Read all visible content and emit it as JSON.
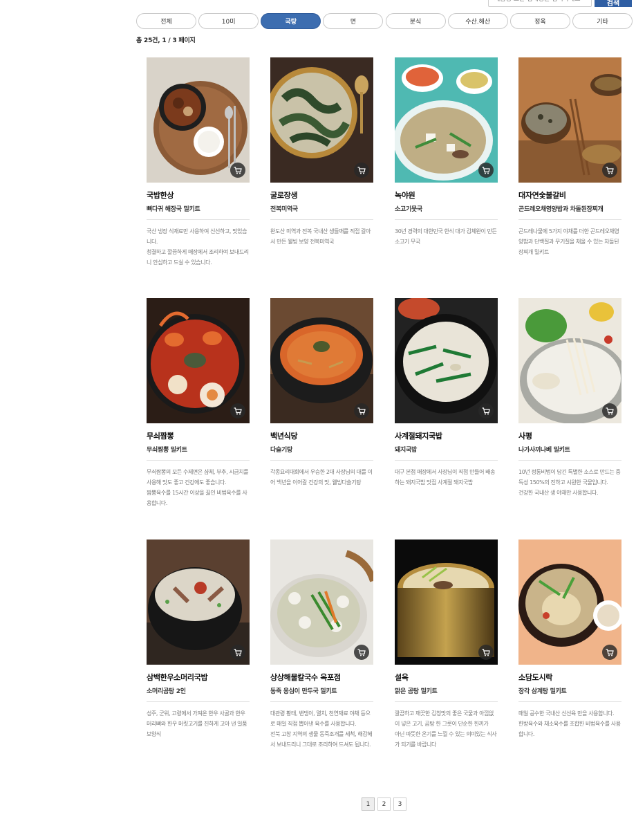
{
  "search": {
    "placeholder": "제품명 또는 업체명을 입력하세요",
    "button_label": "검색"
  },
  "tabs": [
    {
      "label": "전체",
      "active": false
    },
    {
      "label": "10미",
      "active": false
    },
    {
      "label": "국탕",
      "active": true
    },
    {
      "label": "면",
      "active": false
    },
    {
      "label": "분식",
      "active": false
    },
    {
      "label": "수산.해산",
      "active": false
    },
    {
      "label": "정육",
      "active": false
    },
    {
      "label": "기타",
      "active": false
    }
  ],
  "result_summary": "총 25건, 1 / 3 페이지",
  "products": [
    {
      "store": "국밥한상",
      "name": "뼈다귀 해장국 밀키트",
      "desc": "국산 냉장 식재료만 사용하여 신선하고, 맛있습니다.\n청결하고 깔끔하게 매장에서 조리하여 보내드리니 안심하고 드실 수 있습니다.",
      "icon": "cart-icon"
    },
    {
      "store": "굴로장생",
      "name": "전복미역국",
      "desc": "완도산 미역과 전복 국내산 생들깨를 직접 갈아서 만든 웰빙 보양 전복미역국",
      "icon": "cart-icon"
    },
    {
      "store": "녹야원",
      "name": "소고기뭇국",
      "desc": "30년 경력의 대한민국 한식 대가 김체완이 만든 소고기 무국",
      "icon": "cart-icon"
    },
    {
      "store": "대자연숯불갈비",
      "name": "곤드레오채영양밥과 차돌된장찌개",
      "desc": "곤드레나물에 5가지 야채를 더한 곤드레오채영양밥과 단백질과 무기질을 채울 수 있는 차돌된장찌개 밀키트",
      "icon": "cart-icon"
    },
    {
      "store": "무쇠짬뽕",
      "name": "무쇠짬뽕 밀키트",
      "desc": "무쇠짬뽕의 모든 수제면은 샴체, 부추, 시금치를 사용해 맛도 좋고 건강에도 좋습니다.\n짬뽕육수를 15시간 이상을 끓인 비법육수를 사용합니다.",
      "icon": "cart-icon"
    },
    {
      "store": "백년식당",
      "name": "다슬기탕",
      "desc": "각종요리대회에서 우승한 2대 사장님의 대를 이어 백년을 이어갈 건강의 맛, 웰빙다슬기탕",
      "icon": "cart-icon"
    },
    {
      "store": "사계절돼지국밥",
      "name": "돼지국밥",
      "desc": "대구 본점 매장에서 사장님이 직접 만들어 배송하는 돼지국밥 맛집 사계절 돼지국밥",
      "icon": "cart-icon"
    },
    {
      "store": "사평",
      "name": "나가사끼나베 밀키트",
      "desc": "10년 정통비법이 담긴 특별한 소스로 만드는 중독성 150%의 진하고 시원한 국물입니다.\n건강한 국내산 생 야채만 사용합니다.",
      "icon": "cart-icon"
    },
    {
      "store": "삼백한우소머리국밥",
      "name": "소머리곰탕 2인",
      "desc": "성주, 군위, 고령에서 가져온 한우 사골과 한우 머리뼈와 한우 머릿고기를 진하게 고아 낸 일품 보양식",
      "icon": "cart-icon"
    },
    {
      "store": "상상해물칼국수 옥포점",
      "name": "동죽 옹심이 만두국 밀키트",
      "desc": "대관령 황태, 밴댕이, 멸치, 천연재료 야채 등으로 매일 직접 뽑아낸 육수를 사용합니다.\n전북 고창 지역의 생물 동죽조개를 세척, 해감해서 보내드리니 그대로 조리하여 드셔도 됩니다.",
      "icon": "cart-icon"
    },
    {
      "store": "설옥",
      "name": "맑은 곰탕 밀키트",
      "desc": "깔끔하고 깨끗한 김칭맛의 좋은 국물과 아낌없이 넣은 고기, 곰탕 한 그릇이 단순한 한끼가\n아닌 따뜻한 온기를 느낄 수 있는 의미있는 식사가 되기를 바랍니다",
      "icon": "cart-icon"
    },
    {
      "store": "소담도시락",
      "name": "장각 삼계탕 밀키트",
      "desc": "매일 공수한 국내산 신선육 만을 사용합니다.\n한방육수와 채소육수를 조합한 비법육수를 사용합니다.",
      "icon": "cart-icon"
    }
  ],
  "pagination": {
    "pages": [
      "1",
      "2",
      "3"
    ],
    "current": "1"
  }
}
